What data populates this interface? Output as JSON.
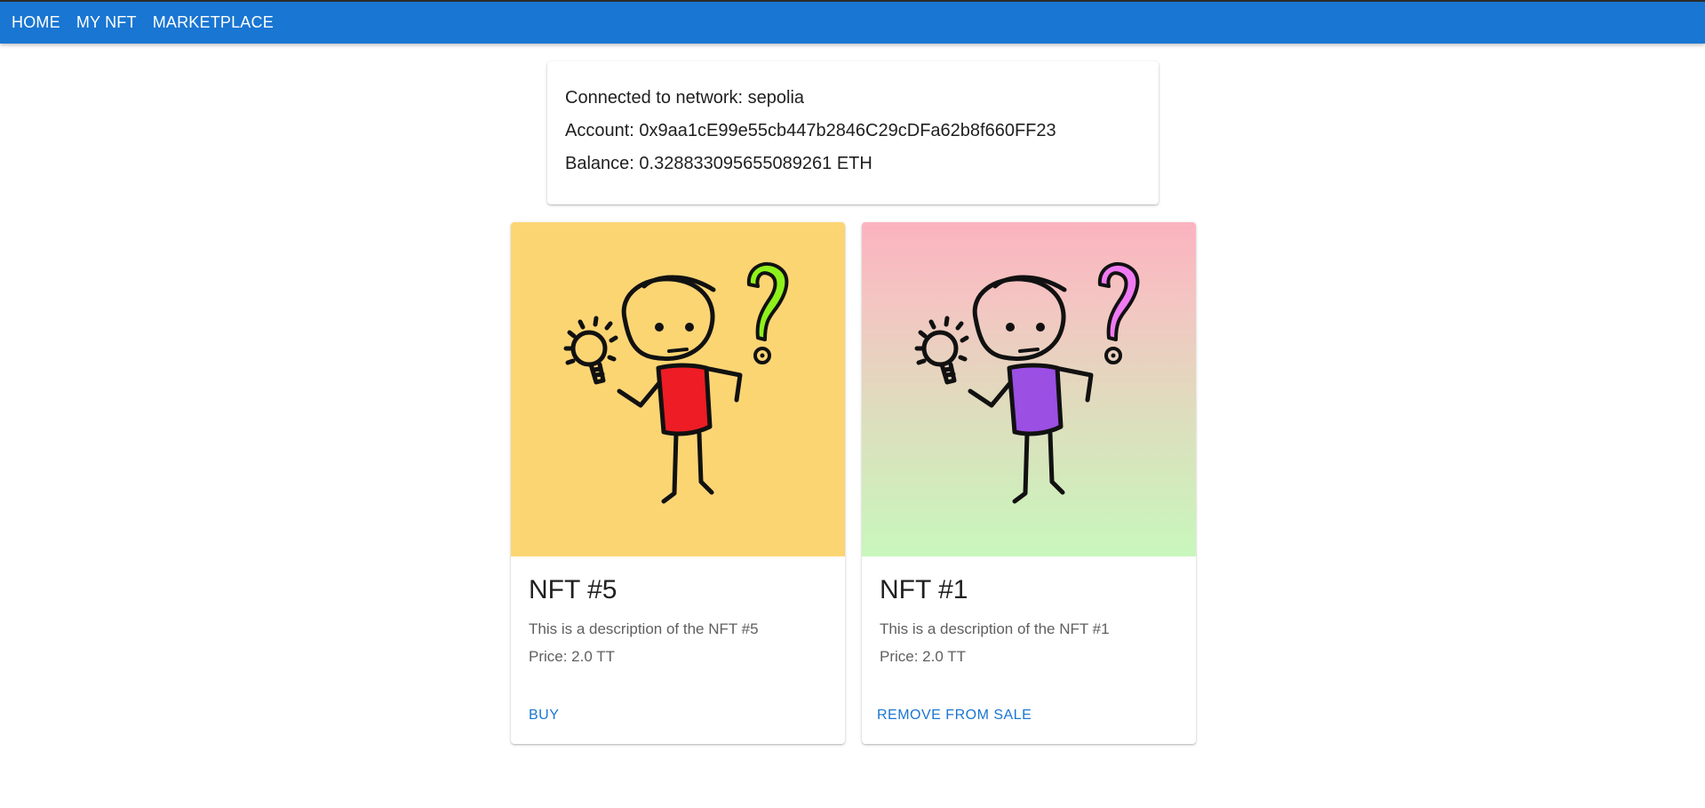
{
  "nav": {
    "home": "HOME",
    "my_nft": "MY NFT",
    "marketplace": "MARKETPLACE"
  },
  "wallet": {
    "network": "Connected to network: sepolia",
    "account": "Account: 0x9aa1cE99e55cb447b2846C29cDFa62b8f660FF23",
    "balance": "Balance: 0.328833095655089261 ETH"
  },
  "cards": [
    {
      "title": "NFT #5",
      "description": "This is a description of the NFT #5",
      "price": "Price: 2.0 TT",
      "action": "BUY",
      "shirt_color": "#ee1c24",
      "mark_color": "#8ef21a",
      "background": "#fcd573"
    },
    {
      "title": "NFT #1",
      "description": "This is a description of the NFT #1",
      "price": "Price: 2.0 TT",
      "action": "REMOVE FROM SALE",
      "shirt_color": "#9b4fe3",
      "mark_color": "#f07af2",
      "background": "pink-to-green gradient"
    }
  ],
  "colors": {
    "primary": "#1976d2",
    "text": "#1f1f1f",
    "secondary_text": "#5f5f5f"
  }
}
